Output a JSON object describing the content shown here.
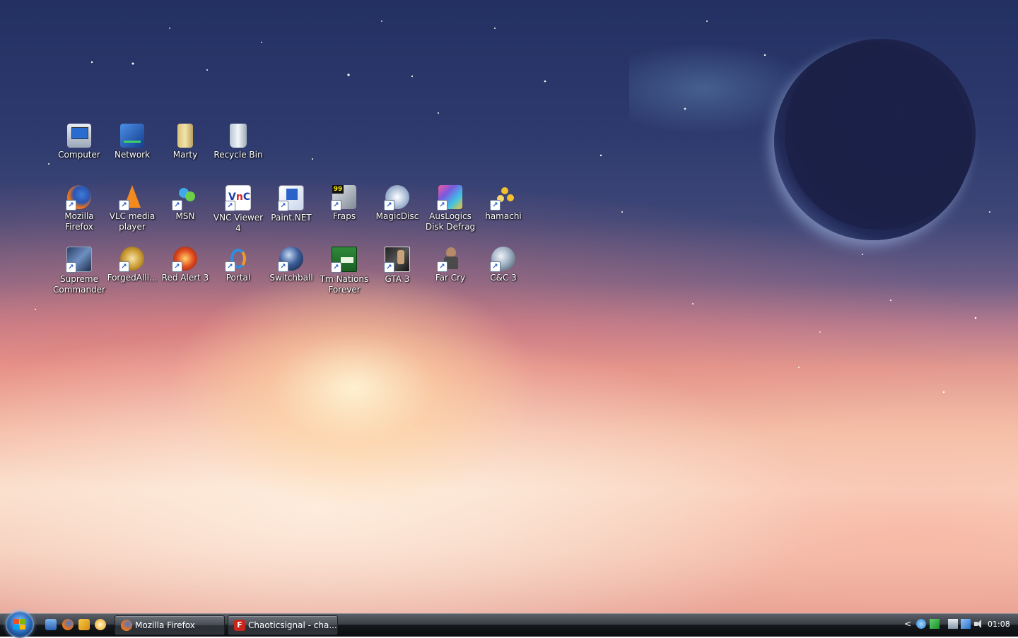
{
  "desktop": {
    "rows": [
      [
        {
          "label": "Computer",
          "icon": "computer-icon"
        },
        {
          "label": "Network",
          "icon": "network-icon"
        },
        {
          "label": "Marty",
          "icon": "user-folder-icon"
        },
        {
          "label": "Recycle Bin",
          "icon": "recycle-bin-icon"
        }
      ],
      [
        {
          "label": "Mozilla Firefox",
          "icon": "firefox-icon"
        },
        {
          "label": "VLC media player",
          "icon": "vlc-icon"
        },
        {
          "label": "MSN",
          "icon": "msn-icon"
        },
        {
          "label": "VNC Viewer 4",
          "icon": "vnc-icon"
        },
        {
          "label": "Paint.NET",
          "icon": "paint-net-icon"
        },
        {
          "label": "Fraps",
          "icon": "fraps-icon"
        },
        {
          "label": "MagicDisc",
          "icon": "magicdisc-icon"
        },
        {
          "label": "AusLogics Disk Defrag",
          "icon": "disk-defrag-icon"
        },
        {
          "label": "hamachi",
          "icon": "hamachi-icon"
        }
      ],
      [
        {
          "label": "Supreme Commander",
          "icon": "supreme-commander-icon"
        },
        {
          "label": "ForgedAlli...",
          "icon": "forged-alliance-icon"
        },
        {
          "label": "Red Alert 3",
          "icon": "red-alert-icon"
        },
        {
          "label": "Portal",
          "icon": "portal-icon"
        },
        {
          "label": "Switchball",
          "icon": "switchball-icon"
        },
        {
          "label": "Tm Nations Forever",
          "icon": "tm-nations-icon"
        },
        {
          "label": "GTA 3",
          "icon": "gta-icon"
        },
        {
          "label": "Far Cry",
          "icon": "far-cry-icon"
        },
        {
          "label": "C&C 3",
          "icon": "cnc-icon"
        }
      ]
    ]
  },
  "taskbar": {
    "quick_launch": [
      "show-desktop-icon",
      "firefox-icon",
      "media-player-icon",
      "messenger-icon"
    ],
    "tasks": [
      {
        "label": "Mozilla Firefox",
        "icon": "firefox-icon"
      },
      {
        "label": "Chaoticsignal - cha...",
        "icon": "filezilla-icon"
      }
    ],
    "tray": {
      "expand": "<",
      "icons": [
        "user-status-icon",
        "network-activity-icon",
        "device-icon",
        "network-icon",
        "volume-icon"
      ],
      "clock": "01:08"
    }
  }
}
